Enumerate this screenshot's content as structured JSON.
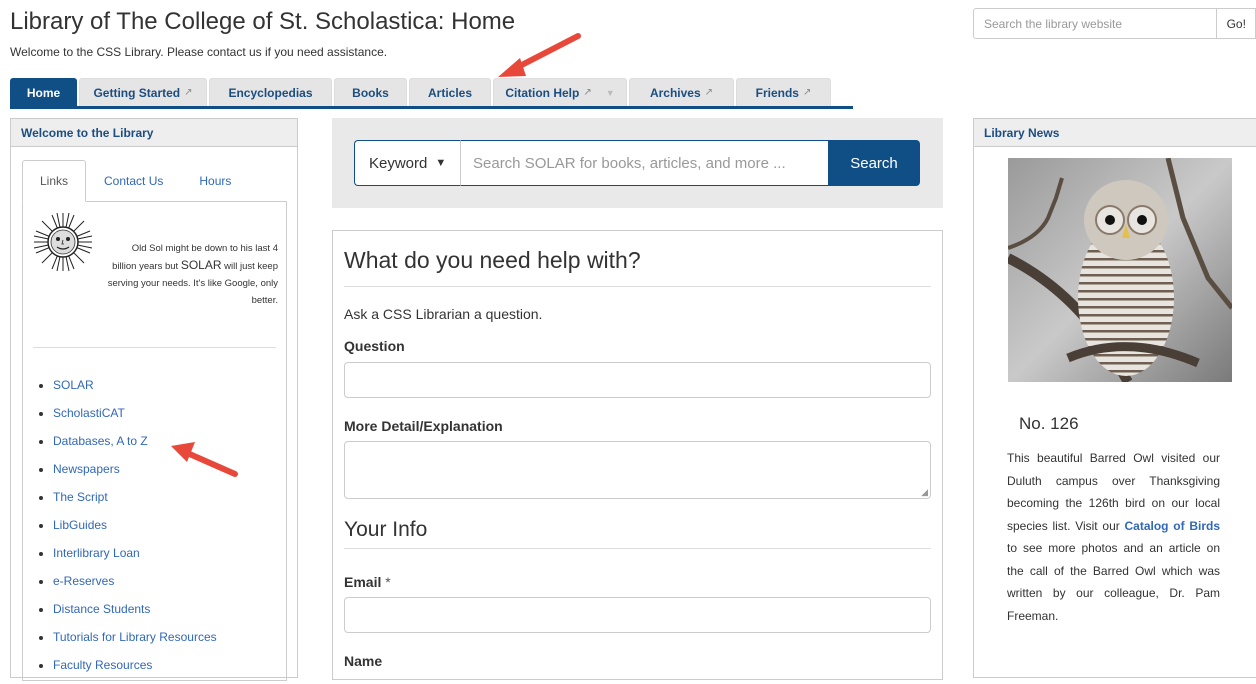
{
  "header": {
    "title": "Library of The College of St. Scholastica: Home",
    "description": "Welcome to the CSS Library. Please contact us if you need assistance.",
    "search_placeholder": "Search the library website",
    "search_button": "Go!"
  },
  "tabs": [
    {
      "label": "Home",
      "active": true,
      "external": false
    },
    {
      "label": "Getting Started",
      "active": false,
      "external": true
    },
    {
      "label": "Encyclopedias",
      "active": false,
      "external": false
    },
    {
      "label": "Books",
      "active": false,
      "external": false
    },
    {
      "label": "Articles",
      "active": false,
      "external": false
    },
    {
      "label": "Citation Help",
      "active": false,
      "external": true,
      "dropdown": true
    },
    {
      "label": "Archives",
      "active": false,
      "external": true
    },
    {
      "label": "Friends",
      "active": false,
      "external": true
    }
  ],
  "left_panel": {
    "heading": "Welcome to the Library",
    "tabs": [
      "Links",
      "Contact Us",
      "Hours"
    ],
    "sol_text_1": "Old Sol might be down to his last 4 billion years but ",
    "sol_text_big": "SOLAR",
    "sol_text_2": " will just keep serving your needs. It's like Google, only better.",
    "links": [
      "SOLAR",
      "ScholastiCAT",
      "Databases, A to Z",
      "Newspapers",
      "The Script",
      "LibGuides",
      "Interlibrary Loan",
      "e-Reserves",
      "Distance Students",
      "Tutorials for Library Resources",
      "Faculty Resources"
    ]
  },
  "solar_search": {
    "scope": "Keyword",
    "placeholder": "Search SOLAR for books, articles, and more ...",
    "button": "Search"
  },
  "help_form": {
    "heading": "What do you need help with?",
    "intro": "Ask a CSS Librarian a question.",
    "question_label": "Question",
    "detail_label": "More Detail/Explanation",
    "your_info_heading": "Your Info",
    "email_label": "Email",
    "required_mark": "*",
    "name_label": "Name"
  },
  "right_panel": {
    "heading": "Library News",
    "news_title": "No. 126",
    "news_text_1": "This beautiful Barred Owl visited our Duluth campus over Thanksgiving becoming the 126th bird on our local species list. Visit our ",
    "news_link": "Catalog of Birds",
    "news_text_2": " to see more photos and an article on the call of the Barred Owl which was written by our colleague, Dr. Pam Freeman."
  },
  "colors": {
    "primary": "#104e86",
    "link": "#3168b7",
    "annotation_arrow": "#e8483a"
  },
  "icons": {
    "external_link": "external-link-icon",
    "dropdown": "chevron-down-icon",
    "logo": "sun-face-logo"
  }
}
